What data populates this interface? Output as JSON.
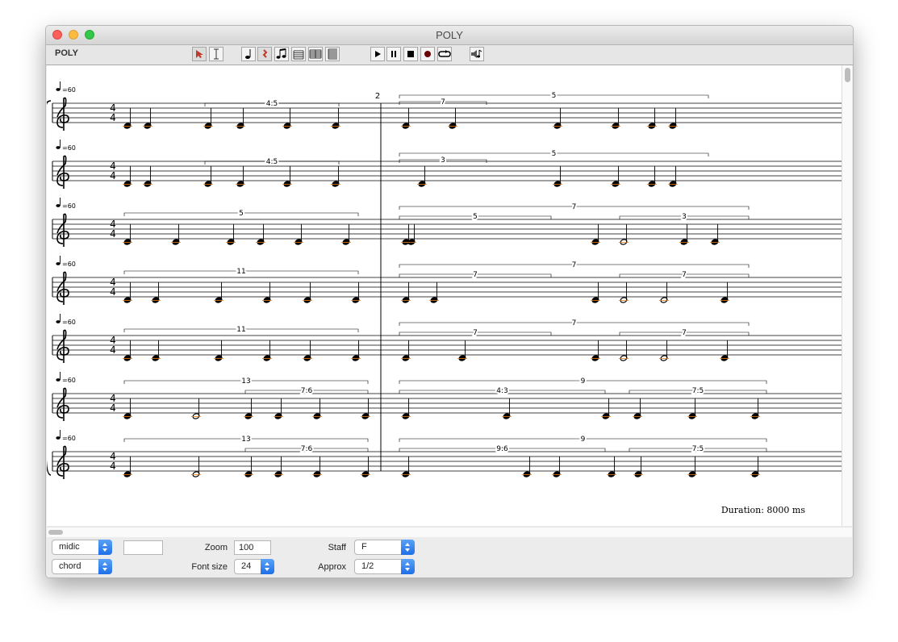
{
  "window": {
    "title": "POLY"
  },
  "toolbar": {
    "label": "POLY",
    "tools": [
      {
        "name": "select-arrow-icon"
      },
      {
        "name": "text-cursor-icon"
      },
      {
        "name": "quarter-note-icon"
      },
      {
        "name": "rest-icon"
      },
      {
        "name": "eighth-notes-icon"
      },
      {
        "name": "measure-icon"
      },
      {
        "name": "voice-icon"
      },
      {
        "name": "system-icon"
      },
      {
        "name": "play-icon"
      },
      {
        "name": "pause-icon"
      },
      {
        "name": "stop-icon"
      },
      {
        "name": "record-icon"
      },
      {
        "name": "loop-icon"
      },
      {
        "name": "speaker-icon"
      }
    ]
  },
  "score": {
    "measure_number": "2",
    "duration": "Duration: 8000 ms",
    "tempo": "=60",
    "time_signature": [
      "4",
      "4"
    ],
    "voices": [
      {
        "m1_tuplets": [
          "4:5"
        ],
        "m2_tuplets": [
          "5",
          "7"
        ]
      },
      {
        "m1_tuplets": [
          "4:5"
        ],
        "m2_tuplets": [
          "5",
          "3"
        ]
      },
      {
        "m1_tuplets": [
          "5"
        ],
        "m2_tuplets": [
          "7",
          "5",
          "3"
        ]
      },
      {
        "m1_tuplets": [
          "11"
        ],
        "m2_tuplets": [
          "7",
          "7",
          "7"
        ]
      },
      {
        "m1_tuplets": [
          "11"
        ],
        "m2_tuplets": [
          "7",
          "7",
          "7"
        ]
      },
      {
        "m1_tuplets": [
          "13",
          "7:6"
        ],
        "m2_tuplets": [
          "9",
          "4:3",
          "7:5"
        ]
      },
      {
        "m1_tuplets": [
          "13",
          "7:6"
        ],
        "m2_tuplets": [
          "9",
          "9:6",
          "7:5"
        ]
      }
    ]
  },
  "controls": {
    "mode": "midic",
    "display": "chord",
    "color_value": "",
    "zoom_label": "Zoom",
    "zoom_value": "100",
    "fontsize_label": "Font size",
    "fontsize_value": "24",
    "staff_label": "Staff",
    "staff_value": "F",
    "approx_label": "Approx",
    "approx_value": "1/2"
  }
}
